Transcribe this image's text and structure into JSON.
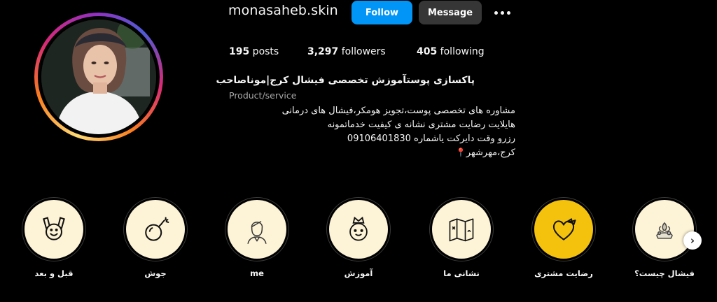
{
  "profile": {
    "username": "monasaheb.skin",
    "follow_label": "Follow",
    "message_label": "Message"
  },
  "stats": {
    "posts_count": "195",
    "posts_label": " posts",
    "followers_count": "3,297",
    "followers_label": " followers",
    "following_count": "405",
    "following_label": " following"
  },
  "bio": {
    "name": "پاکسازی پوستآموزش تخصصی فیشال کرج|موناصاحب",
    "category": "Product/service",
    "line1": "مشاوره های تخصصی پوست،تجویز هومکر،فیشال های درمانی",
    "line2": "هایلایت رضایت مشتری نشانه ی کیفیت خدماتمونه",
    "line3": "رزرو وقت دایرکت یاشماره 09106401830",
    "line4": "کرج،مهرشهر"
  },
  "highlights": [
    {
      "label": "قبل و بعد",
      "icon": "happy-face-icon"
    },
    {
      "label": "جوش",
      "icon": "bomb-icon"
    },
    {
      "label": "me",
      "icon": "woman-portrait-icon"
    },
    {
      "label": "آموزش",
      "icon": "crowned-face-icon"
    },
    {
      "label": "نشانی ما",
      "icon": "map-icon"
    },
    {
      "label": "رضایت مشتری",
      "icon": "heart-bow-icon"
    },
    {
      "label": "فیشال چیست؟",
      "icon": "spa-products-icon"
    }
  ],
  "colors": {
    "follow_blue": "#0095f6",
    "message_gray": "#363636",
    "highlight_cream": "#fdf3d6",
    "highlight_yellow": "#f4c20d"
  }
}
